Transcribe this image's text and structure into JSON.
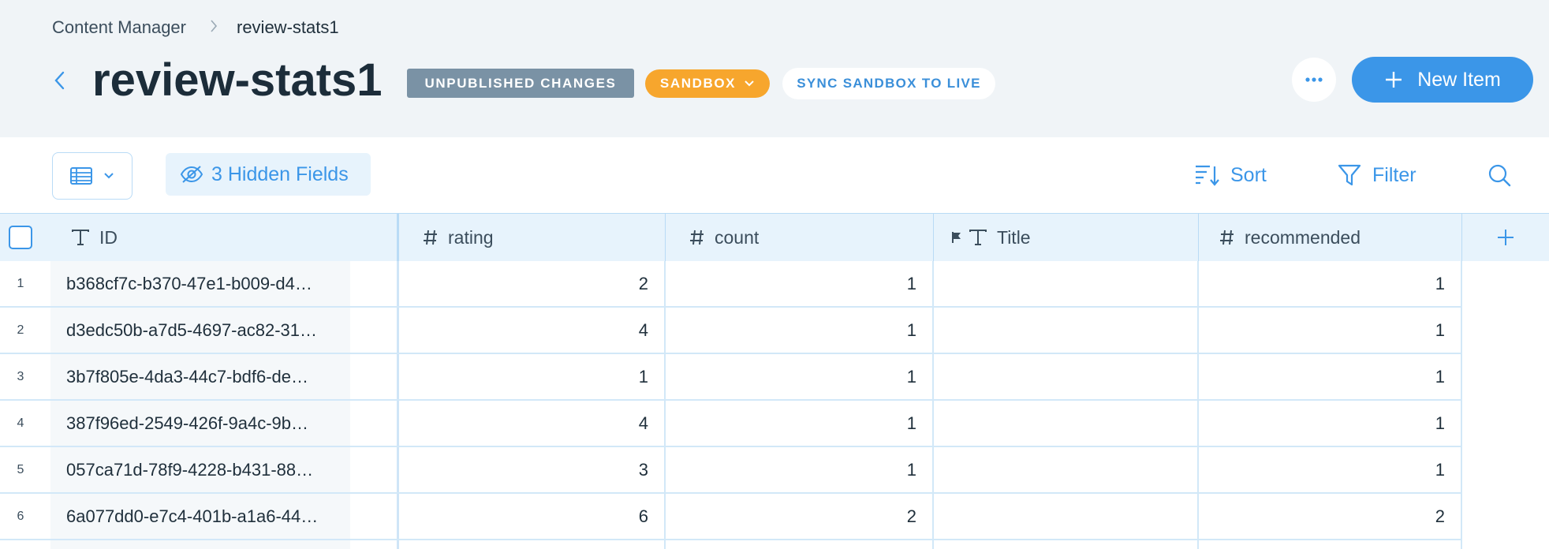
{
  "breadcrumb": {
    "root": "Content Manager",
    "current": "review-stats1"
  },
  "page": {
    "title": "review-stats1",
    "badge_unpublished": "UNPUBLISHED CHANGES",
    "badge_sandbox": "SANDBOX",
    "sync_label": "SYNC SANDBOX TO LIVE",
    "new_item_label": "New Item"
  },
  "toolbar": {
    "hidden_fields_label": "3 Hidden Fields",
    "sort_label": "Sort",
    "filter_label": "Filter"
  },
  "table": {
    "columns": [
      "ID",
      "rating",
      "count",
      "Title",
      "recommended"
    ],
    "rows": [
      {
        "num": "1",
        "id": "b368cf7c-b370-47e1-b009-d4…",
        "rating": "2",
        "count": "1",
        "title": "",
        "recommended": "1"
      },
      {
        "num": "2",
        "id": "d3edc50b-a7d5-4697-ac82-31…",
        "rating": "4",
        "count": "1",
        "title": "",
        "recommended": "1"
      },
      {
        "num": "3",
        "id": "3b7f805e-4da3-44c7-bdf6-de…",
        "rating": "1",
        "count": "1",
        "title": "",
        "recommended": "1"
      },
      {
        "num": "4",
        "id": "387f96ed-2549-426f-9a4c-9b…",
        "rating": "4",
        "count": "1",
        "title": "",
        "recommended": "1"
      },
      {
        "num": "5",
        "id": "057ca71d-78f9-4228-b431-88…",
        "rating": "3",
        "count": "1",
        "title": "",
        "recommended": "1"
      },
      {
        "num": "6",
        "id": "6a077dd0-e7c4-401b-a1a6-44…",
        "rating": "6",
        "count": "2",
        "title": "",
        "recommended": "2"
      }
    ]
  },
  "colors": {
    "accent": "#3b96e8",
    "sandbox": "#f7a62d",
    "unpublished": "#7a92a5",
    "header_bg": "#f0f4f7"
  }
}
